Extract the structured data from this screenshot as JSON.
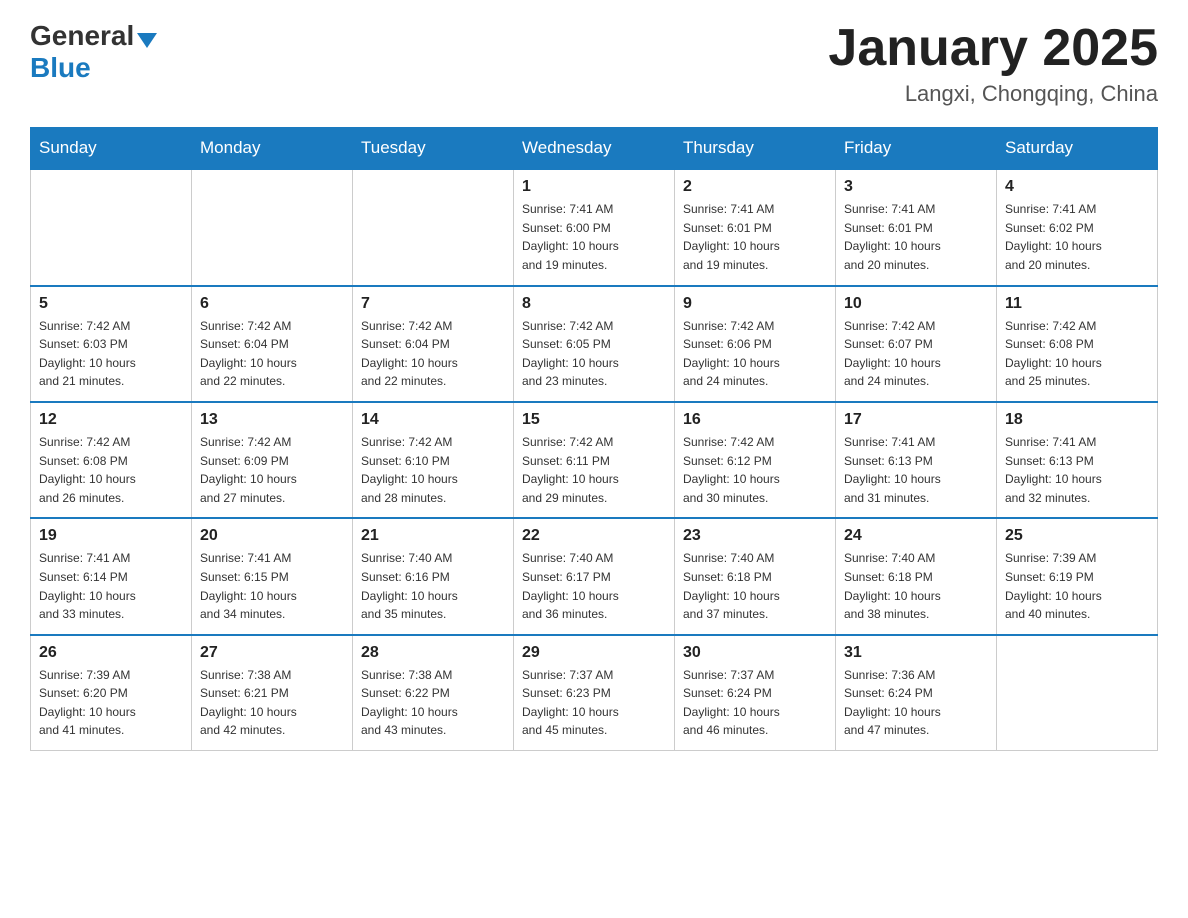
{
  "header": {
    "logo_general": "General",
    "logo_blue": "Blue",
    "title": "January 2025",
    "subtitle": "Langxi, Chongqing, China"
  },
  "days_of_week": [
    "Sunday",
    "Monday",
    "Tuesday",
    "Wednesday",
    "Thursday",
    "Friday",
    "Saturday"
  ],
  "weeks": [
    [
      {
        "day": "",
        "info": ""
      },
      {
        "day": "",
        "info": ""
      },
      {
        "day": "",
        "info": ""
      },
      {
        "day": "1",
        "info": "Sunrise: 7:41 AM\nSunset: 6:00 PM\nDaylight: 10 hours\nand 19 minutes."
      },
      {
        "day": "2",
        "info": "Sunrise: 7:41 AM\nSunset: 6:01 PM\nDaylight: 10 hours\nand 19 minutes."
      },
      {
        "day": "3",
        "info": "Sunrise: 7:41 AM\nSunset: 6:01 PM\nDaylight: 10 hours\nand 20 minutes."
      },
      {
        "day": "4",
        "info": "Sunrise: 7:41 AM\nSunset: 6:02 PM\nDaylight: 10 hours\nand 20 minutes."
      }
    ],
    [
      {
        "day": "5",
        "info": "Sunrise: 7:42 AM\nSunset: 6:03 PM\nDaylight: 10 hours\nand 21 minutes."
      },
      {
        "day": "6",
        "info": "Sunrise: 7:42 AM\nSunset: 6:04 PM\nDaylight: 10 hours\nand 22 minutes."
      },
      {
        "day": "7",
        "info": "Sunrise: 7:42 AM\nSunset: 6:04 PM\nDaylight: 10 hours\nand 22 minutes."
      },
      {
        "day": "8",
        "info": "Sunrise: 7:42 AM\nSunset: 6:05 PM\nDaylight: 10 hours\nand 23 minutes."
      },
      {
        "day": "9",
        "info": "Sunrise: 7:42 AM\nSunset: 6:06 PM\nDaylight: 10 hours\nand 24 minutes."
      },
      {
        "day": "10",
        "info": "Sunrise: 7:42 AM\nSunset: 6:07 PM\nDaylight: 10 hours\nand 24 minutes."
      },
      {
        "day": "11",
        "info": "Sunrise: 7:42 AM\nSunset: 6:08 PM\nDaylight: 10 hours\nand 25 minutes."
      }
    ],
    [
      {
        "day": "12",
        "info": "Sunrise: 7:42 AM\nSunset: 6:08 PM\nDaylight: 10 hours\nand 26 minutes."
      },
      {
        "day": "13",
        "info": "Sunrise: 7:42 AM\nSunset: 6:09 PM\nDaylight: 10 hours\nand 27 minutes."
      },
      {
        "day": "14",
        "info": "Sunrise: 7:42 AM\nSunset: 6:10 PM\nDaylight: 10 hours\nand 28 minutes."
      },
      {
        "day": "15",
        "info": "Sunrise: 7:42 AM\nSunset: 6:11 PM\nDaylight: 10 hours\nand 29 minutes."
      },
      {
        "day": "16",
        "info": "Sunrise: 7:42 AM\nSunset: 6:12 PM\nDaylight: 10 hours\nand 30 minutes."
      },
      {
        "day": "17",
        "info": "Sunrise: 7:41 AM\nSunset: 6:13 PM\nDaylight: 10 hours\nand 31 minutes."
      },
      {
        "day": "18",
        "info": "Sunrise: 7:41 AM\nSunset: 6:13 PM\nDaylight: 10 hours\nand 32 minutes."
      }
    ],
    [
      {
        "day": "19",
        "info": "Sunrise: 7:41 AM\nSunset: 6:14 PM\nDaylight: 10 hours\nand 33 minutes."
      },
      {
        "day": "20",
        "info": "Sunrise: 7:41 AM\nSunset: 6:15 PM\nDaylight: 10 hours\nand 34 minutes."
      },
      {
        "day": "21",
        "info": "Sunrise: 7:40 AM\nSunset: 6:16 PM\nDaylight: 10 hours\nand 35 minutes."
      },
      {
        "day": "22",
        "info": "Sunrise: 7:40 AM\nSunset: 6:17 PM\nDaylight: 10 hours\nand 36 minutes."
      },
      {
        "day": "23",
        "info": "Sunrise: 7:40 AM\nSunset: 6:18 PM\nDaylight: 10 hours\nand 37 minutes."
      },
      {
        "day": "24",
        "info": "Sunrise: 7:40 AM\nSunset: 6:18 PM\nDaylight: 10 hours\nand 38 minutes."
      },
      {
        "day": "25",
        "info": "Sunrise: 7:39 AM\nSunset: 6:19 PM\nDaylight: 10 hours\nand 40 minutes."
      }
    ],
    [
      {
        "day": "26",
        "info": "Sunrise: 7:39 AM\nSunset: 6:20 PM\nDaylight: 10 hours\nand 41 minutes."
      },
      {
        "day": "27",
        "info": "Sunrise: 7:38 AM\nSunset: 6:21 PM\nDaylight: 10 hours\nand 42 minutes."
      },
      {
        "day": "28",
        "info": "Sunrise: 7:38 AM\nSunset: 6:22 PM\nDaylight: 10 hours\nand 43 minutes."
      },
      {
        "day": "29",
        "info": "Sunrise: 7:37 AM\nSunset: 6:23 PM\nDaylight: 10 hours\nand 45 minutes."
      },
      {
        "day": "30",
        "info": "Sunrise: 7:37 AM\nSunset: 6:24 PM\nDaylight: 10 hours\nand 46 minutes."
      },
      {
        "day": "31",
        "info": "Sunrise: 7:36 AM\nSunset: 6:24 PM\nDaylight: 10 hours\nand 47 minutes."
      },
      {
        "day": "",
        "info": ""
      }
    ]
  ]
}
